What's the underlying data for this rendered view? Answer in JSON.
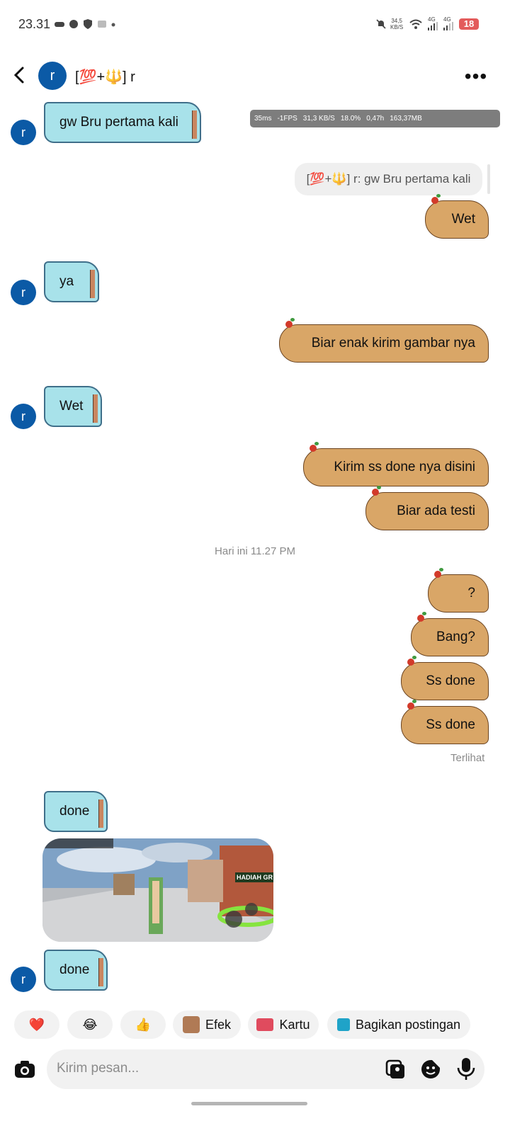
{
  "status_bar": {
    "time": "23.31",
    "network_speed": "34,5",
    "network_unit": "KB/S",
    "sig1": "4G",
    "sig2": "4G",
    "battery": "18"
  },
  "header": {
    "contact_name": "[💯+🔱] r",
    "avatar_letter": "r"
  },
  "fps_overlay": {
    "ping": "35ms",
    "fps": "-1FPS",
    "speed": "31,3 KB/S",
    "battery": "18.0%",
    "time": "0,47h",
    "memory": "163,37MB"
  },
  "messages": [
    {
      "side": "received",
      "text": "gw Bru pertama kali"
    },
    {
      "side": "sent",
      "reply_to": "[💯+🔱] r: gw Bru pertama kali",
      "text": "Wet"
    },
    {
      "side": "received",
      "text": "ya"
    },
    {
      "side": "sent",
      "text": "Biar enak kirim gambar nya"
    },
    {
      "side": "received",
      "text": "Wet"
    },
    {
      "side": "sent",
      "text": "Kirim ss done nya disini"
    },
    {
      "side": "sent",
      "text": "Biar ada testi"
    },
    {
      "side": "sent",
      "text": "?"
    },
    {
      "side": "sent",
      "text": "Bang?"
    },
    {
      "side": "sent",
      "text": "Ss done"
    },
    {
      "side": "sent",
      "text": "Ss done"
    },
    {
      "side": "received",
      "text": "done"
    },
    {
      "side": "received",
      "type": "image",
      "overlay_text": "HADIAH GR"
    },
    {
      "side": "received",
      "text": "done"
    }
  ],
  "time_divider": "Hari ini 11.27 PM",
  "seen_label": "Terlihat",
  "quick_reactions": [
    {
      "icon": "heart-icon",
      "glyph": "❤️"
    },
    {
      "icon": "laugh-icon",
      "glyph": "😂"
    },
    {
      "icon": "thumbs-up-icon",
      "glyph": "👍"
    },
    {
      "icon": "effects-icon",
      "label": "Efek"
    },
    {
      "icon": "card-icon",
      "label": "Kartu"
    },
    {
      "icon": "share-icon",
      "label": "Bagikan postingan"
    }
  ],
  "composer": {
    "placeholder": "Kirim pesan..."
  }
}
